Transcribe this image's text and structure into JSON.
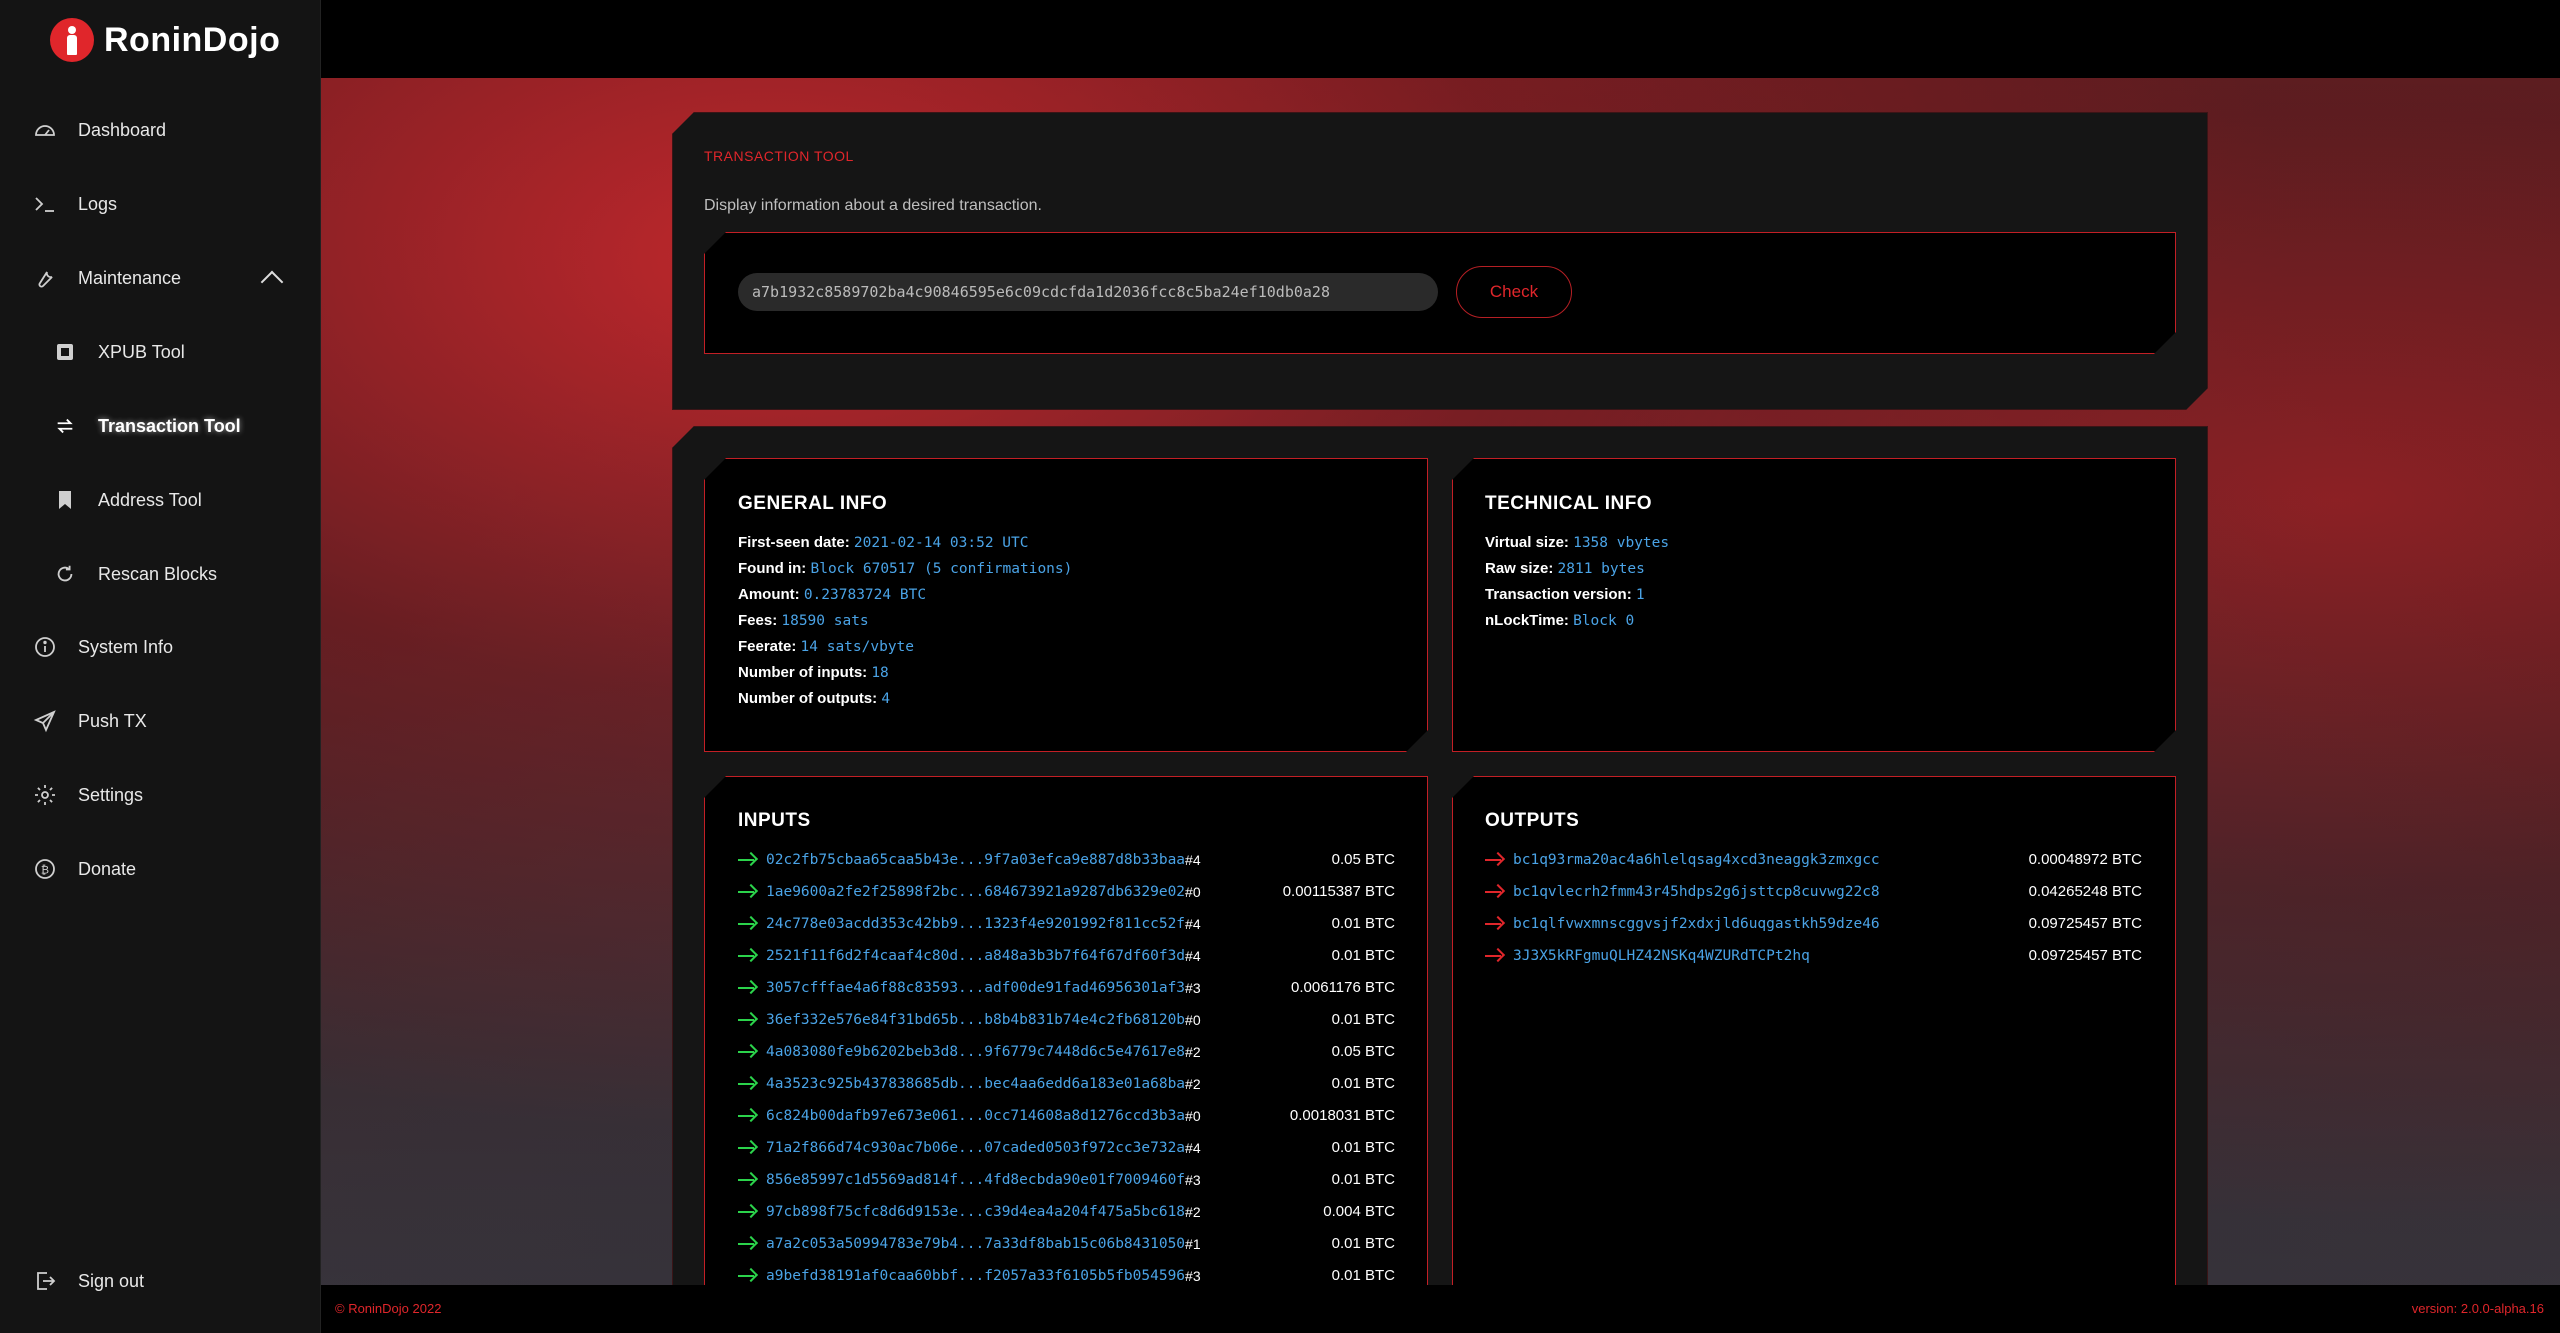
{
  "brand": {
    "name": "RoninDojo"
  },
  "sidebar": {
    "items": [
      {
        "label": "Dashboard",
        "icon": "dashboard-icon"
      },
      {
        "label": "Logs",
        "icon": "terminal-icon"
      },
      {
        "label": "Maintenance",
        "icon": "wrench-icon"
      },
      {
        "label": "XPUB Tool",
        "icon": "square-icon"
      },
      {
        "label": "Transaction Tool",
        "icon": "swap-arrows-icon"
      },
      {
        "label": "Address Tool",
        "icon": "bookmark-icon"
      },
      {
        "label": "Rescan Blocks",
        "icon": "refresh-icon"
      },
      {
        "label": "System Info",
        "icon": "info-icon"
      },
      {
        "label": "Push TX",
        "icon": "send-icon"
      },
      {
        "label": "Settings",
        "icon": "gear-icon"
      },
      {
        "label": "Donate",
        "icon": "bitcoin-icon"
      }
    ],
    "signout": "Sign out",
    "active_item": "Transaction Tool"
  },
  "tool": {
    "title": "TRANSACTION TOOL",
    "description": "Display information about a desired transaction.",
    "txid_value": "a7b1932c8589702ba4c90846595e6c09cdcfda1d2036fcc8c5ba24ef10db0a28",
    "check_label": "Check"
  },
  "general": {
    "title": "GENERAL INFO",
    "first_seen_label": "First-seen date:",
    "first_seen": "2021-02-14 03:52 UTC",
    "found_in_label": "Found in:",
    "found_in": "Block 670517 (5 confirmations)",
    "amount_label": "Amount:",
    "amount": "0.23783724 BTC",
    "fees_label": "Fees:",
    "fees": "18590 sats",
    "feerate_label": "Feerate:",
    "feerate": "14 sats/vbyte",
    "num_inputs_label": "Number of inputs:",
    "num_inputs": "18",
    "num_outputs_label": "Number of outputs:",
    "num_outputs": "4"
  },
  "technical": {
    "title": "TECHNICAL INFO",
    "vsize_label": "Virtual size:",
    "vsize": "1358 vbytes",
    "rawsize_label": "Raw size:",
    "rawsize": "2811 bytes",
    "version_label": "Transaction version:",
    "version": "1",
    "locktime_label": "nLockTime:",
    "locktime": "Block 0"
  },
  "inputs": {
    "title": "INPUTS",
    "rows": [
      {
        "txid": "02c2fb75cbaa65caa5b43e...9f7a03efca9e887d8b33baa",
        "vout": "#4",
        "amount": "0.05 BTC"
      },
      {
        "txid": "1ae9600a2fe2f25898f2bc...684673921a9287db6329e02",
        "vout": "#0",
        "amount": "0.00115387 BTC"
      },
      {
        "txid": "24c778e03acdd353c42bb9...1323f4e9201992f811cc52f",
        "vout": "#4",
        "amount": "0.01 BTC"
      },
      {
        "txid": "2521f11f6d2f4caaf4c80d...a848a3b3b7f64f67df60f3d",
        "vout": "#4",
        "amount": "0.01 BTC"
      },
      {
        "txid": "3057cfffae4a6f88c83593...adf00de91fad46956301af3",
        "vout": "#3",
        "amount": "0.0061176 BTC"
      },
      {
        "txid": "36ef332e576e84f31bd65b...b8b4b831b74e4c2fb68120b",
        "vout": "#0",
        "amount": "0.01 BTC"
      },
      {
        "txid": "4a083080fe9b6202beb3d8...9f6779c7448d6c5e47617e8",
        "vout": "#2",
        "amount": "0.05 BTC"
      },
      {
        "txid": "4a3523c925b437838685db...bec4aa6edd6a183e01a68ba",
        "vout": "#2",
        "amount": "0.01 BTC"
      },
      {
        "txid": "6c824b00dafb97e673e061...0cc714608a8d1276ccd3b3a",
        "vout": "#0",
        "amount": "0.0018031 BTC"
      },
      {
        "txid": "71a2f866d74c930ac7b06e...07caded0503f972cc3e732a",
        "vout": "#4",
        "amount": "0.01 BTC"
      },
      {
        "txid": "856e85997c1d5569ad814f...4fd8ecbda90e01f7009460f",
        "vout": "#3",
        "amount": "0.01 BTC"
      },
      {
        "txid": "97cb898f75cfc8d6d9153e...c39d4ea4a204f475a5bc618",
        "vout": "#2",
        "amount": "0.004 BTC"
      },
      {
        "txid": "a7a2c053a50994783e79b4...7a33df8bab15c06b8431050",
        "vout": "#1",
        "amount": "0.01 BTC"
      },
      {
        "txid": "a9befd38191af0caa60bbf...f2057a33f6105b5fb054596",
        "vout": "#3",
        "amount": "0.01 BTC"
      }
    ]
  },
  "outputs": {
    "title": "OUTPUTS",
    "rows": [
      {
        "address": "bc1q93rma20ac4a6hlelqsag4xcd3neaggk3zmxgcc",
        "amount": "0.00048972 BTC"
      },
      {
        "address": "bc1qvlecrh2fmm43r45hdps2g6jsttcp8cuvwg22c8",
        "amount": "0.04265248 BTC"
      },
      {
        "address": "bc1qlfvwxmnscggvsjf2xdxjld6uqgastkh59dze46",
        "amount": "0.09725457 BTC"
      },
      {
        "address": "3J3X5kRFgmuQLHZ42NSKq4WZURdTCPt2hq",
        "amount": "0.09725457 BTC"
      }
    ]
  },
  "footer": {
    "copyright": "© RoninDojo 2022",
    "version": "version: 2.0.0-alpha.16"
  },
  "colors": {
    "accent": "#e0262b",
    "link": "#4aa3e6",
    "input_arrow": "#2bd34b"
  }
}
